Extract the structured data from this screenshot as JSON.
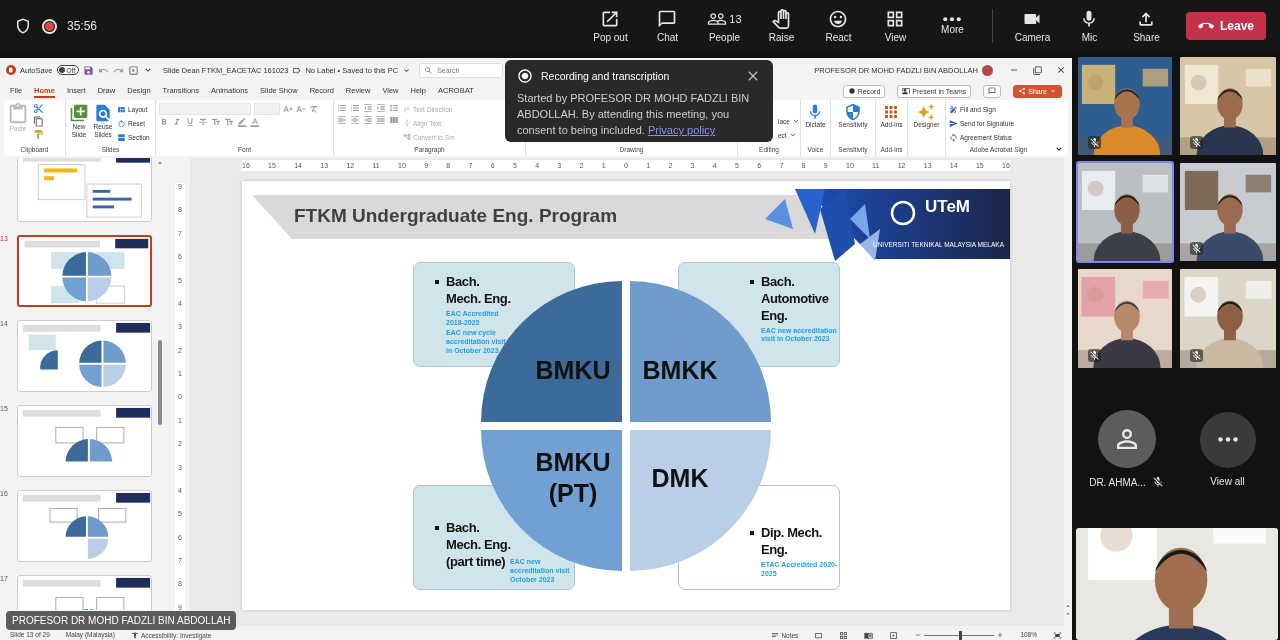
{
  "meeting_bar": {
    "recording": true,
    "timer": "35:56",
    "controls": [
      {
        "kind": "popout",
        "label": "Pop out"
      },
      {
        "kind": "chat",
        "label": "Chat"
      },
      {
        "kind": "people",
        "label": "People",
        "count": "13"
      },
      {
        "kind": "raise",
        "label": "Raise"
      },
      {
        "kind": "react",
        "label": "React"
      },
      {
        "kind": "view",
        "label": "View"
      },
      {
        "kind": "more",
        "label": "More"
      },
      {
        "kind": "camera",
        "label": "Camera"
      },
      {
        "kind": "mic",
        "label": "Mic"
      },
      {
        "kind": "share",
        "label": "Share"
      }
    ],
    "leave": "Leave"
  },
  "powerpoint": {
    "titlebar": {
      "autosave": "AutoSave",
      "autosave_toggle": "Off",
      "autosave_on": false,
      "filename": "Slide Dean FTKM_EACETAC 161023",
      "status": "No Label • Saved to this PC",
      "search_placeholder": "Search",
      "user": "PROFESOR DR MOHD FADZLI BIN ABDOLLAH"
    },
    "menu_tabs": [
      {
        "label": "File",
        "selected": false
      },
      {
        "label": "Home",
        "selected": true
      },
      {
        "label": "Insert",
        "selected": false
      },
      {
        "label": "Draw",
        "selected": false
      },
      {
        "label": "Design",
        "selected": false
      },
      {
        "label": "Transitions",
        "selected": false
      },
      {
        "label": "Animations",
        "selected": false
      },
      {
        "label": "Slide Show",
        "selected": false
      },
      {
        "label": "Record",
        "selected": false
      },
      {
        "label": "Review",
        "selected": false
      },
      {
        "label": "View",
        "selected": false
      },
      {
        "label": "Help",
        "selected": false
      },
      {
        "label": "ACROBAT",
        "selected": false
      }
    ],
    "tab_actions": [
      {
        "kind": "record",
        "label": "Record"
      },
      {
        "kind": "teams",
        "label": "Present in Teams"
      },
      {
        "kind": "comment"
      },
      {
        "kind": "share",
        "label": "Share"
      }
    ],
    "ribbon_groups": [
      {
        "kind": "clipboard",
        "name": "Clipboard",
        "items": [
          {
            "label": "Paste",
            "disabled": true
          }
        ]
      },
      {
        "kind": "slides",
        "name": "Slides",
        "items": [
          {
            "label": "New\nSlide"
          },
          {
            "label": "Reuse\nSlides"
          },
          {
            "label": "Layout"
          },
          {
            "label": "Reset"
          },
          {
            "label": "Section"
          }
        ]
      },
      {
        "kind": "font",
        "name": "Font"
      },
      {
        "kind": "paragraph",
        "name": "Paragraph",
        "items": [
          {
            "label": "Text Direction",
            "disabled": true
          },
          {
            "label": "Align Text",
            "disabled": true
          },
          {
            "label": "Convert to Sm",
            "disabled": true
          }
        ]
      },
      {
        "kind": "drawing",
        "name": "Drawing"
      },
      {
        "kind": "editing",
        "name": "Editing",
        "items": [
          {
            "label": "lace"
          },
          {
            "label": "ect"
          }
        ]
      },
      {
        "kind": "large",
        "name": "Voice",
        "items": [
          {
            "label": "Dictate"
          }
        ]
      },
      {
        "kind": "large",
        "name": "Sensitivity",
        "items": [
          {
            "label": "Sensitivity"
          }
        ]
      },
      {
        "kind": "large",
        "name": "Add-ins",
        "items": [
          {
            "label": "Add-ins"
          }
        ]
      },
      {
        "kind": "large",
        "items": [
          {
            "label": "Designer"
          }
        ]
      },
      {
        "kind": "list",
        "name": "Adobe Acrobat Sign",
        "items": [
          {
            "label": "Fill and Sign"
          },
          {
            "label": "Send for Signature"
          },
          {
            "label": "Agreement Status"
          }
        ]
      }
    ],
    "thumbnails": [
      {
        "kind": "bars",
        "selected": false
      },
      {
        "number": "13",
        "kind": "quad",
        "selected": true
      },
      {
        "number": "14",
        "kind": "quad-side",
        "selected": false
      },
      {
        "number": "15",
        "kind": "half",
        "selected": false
      },
      {
        "number": "16",
        "kind": "tri",
        "selected": false
      },
      {
        "number": "17",
        "kind": "half",
        "selected": false
      }
    ],
    "ruler_h": [
      "16",
      "15",
      "14",
      "13",
      "12",
      "11",
      "10",
      "9",
      "8",
      "7",
      "6",
      "5",
      "4",
      "3",
      "2",
      "1",
      "0",
      "1",
      "2",
      "3",
      "4",
      "5",
      "6",
      "7",
      "8",
      "9",
      "10",
      "11",
      "12",
      "13",
      "14",
      "15",
      "16"
    ],
    "ruler_v": [
      "9",
      "8",
      "7",
      "6",
      "5",
      "4",
      "3",
      "2",
      "1",
      "0",
      "1",
      "2",
      "3",
      "4",
      "5",
      "6",
      "7",
      "8",
      "9"
    ],
    "slide": {
      "title": "FTKM Undergraduate Eng. Program",
      "logo": "UTeM",
      "logo_subtitle": "UNIVERSITI TEKNIKAL MALAYSIA MELAKA",
      "quadrants": [
        {
          "label": "BMKU",
          "color": "#3d6b99"
        },
        {
          "label": "BMKK",
          "color": "#6f9bcd"
        },
        {
          "label": "BMKU\n(PT)",
          "color": "#72a0d2"
        },
        {
          "label": "DMK",
          "color": "#bacee8"
        }
      ],
      "boxes": [
        {
          "title": "Bach.\nMech. Eng.",
          "color": "#cfe5eb",
          "notes": [
            "EAC Accredited 2018-2023",
            "EAC new cycle accreditation visit in October 2023"
          ]
        },
        {
          "title": "Bach.\nAutomotive\nEng.",
          "color": "#cfe5eb",
          "notes": [
            "EAC new accreditation visit in October 2023"
          ]
        },
        {
          "title": "Bach.\nMech. Eng.\n(part time)",
          "color": "#cfe5eb",
          "notes": [
            "EAC new accreditation visit October 2023"
          ]
        },
        {
          "title": "Dip. Mech.\nEng.",
          "color": "#ffffff",
          "notes": [
            "ETAC Accredited 2020-2025"
          ]
        }
      ]
    },
    "status_bar": {
      "slide": "Slide 13 of 29",
      "language": "Malay (Malaysia)",
      "accessibility": "Accessibility: Investigate",
      "notes": "Notes",
      "zoom_slider": {
        "level": 0.5
      },
      "zoom": "108%"
    }
  },
  "presenter_label": "PROFESOR DR MOHD FADZLI BIN ABDOLLAH",
  "notice": {
    "title": "Recording and transcription",
    "body": "Started by PROFESOR DR MOHD FADZLI BIN ABDOLLAH. By attending this meeting, you consent to being included.",
    "link": "Privacy policy"
  },
  "participants": [
    {
      "muted": true,
      "selected": false
    },
    {
      "muted": true,
      "selected": false
    },
    {
      "muted": false,
      "selected": true
    },
    {
      "muted": true,
      "selected": false
    },
    {
      "muted": true,
      "selected": false
    },
    {
      "muted": true,
      "selected": false
    }
  ],
  "avatars": [
    {
      "kind": "person",
      "name": "DR. AHMA...",
      "muted": true
    },
    {
      "kind": "more",
      "name": "View all"
    }
  ]
}
